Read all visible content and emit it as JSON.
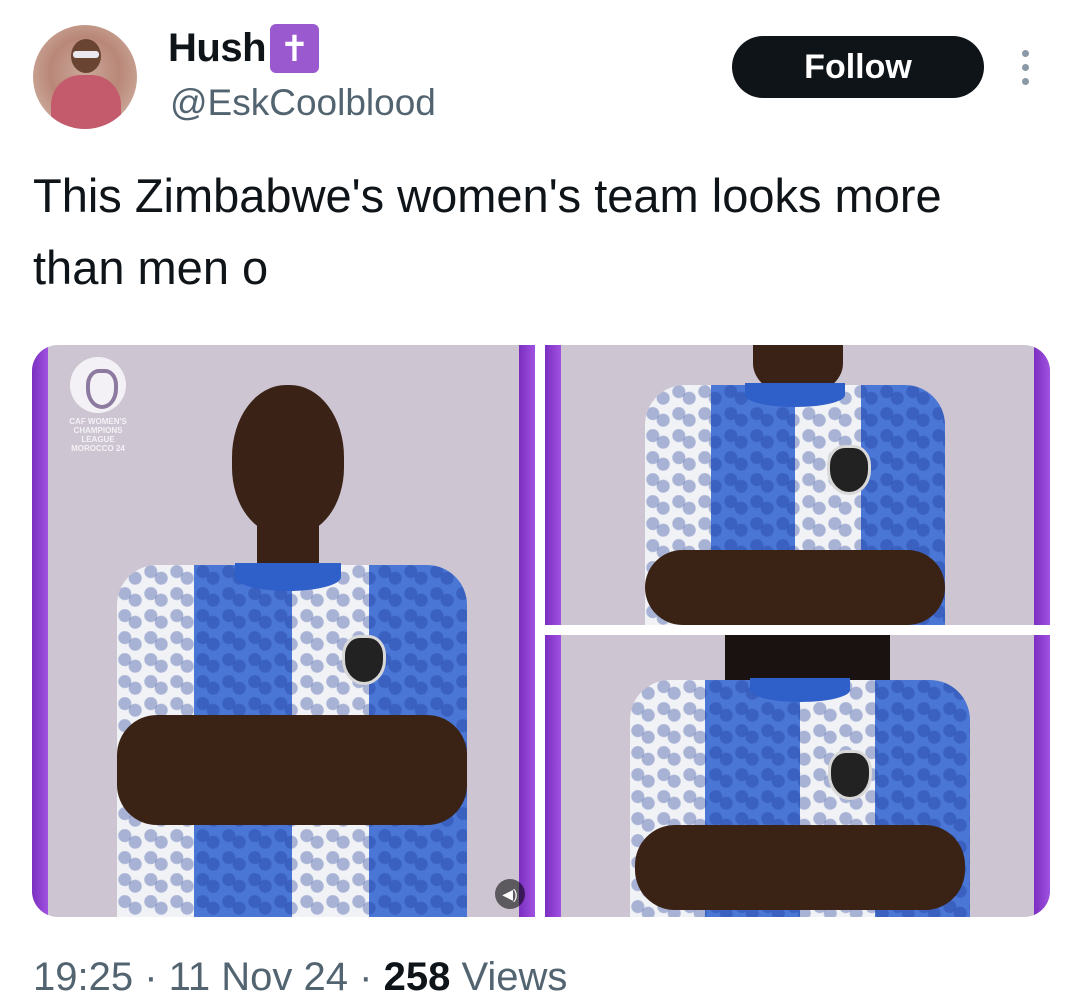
{
  "user": {
    "display_name": "Hush",
    "badge_glyph": "✝",
    "handle": "@EskCoolblood",
    "avatar_icon": "avatar"
  },
  "actions": {
    "follow_label": "Follow",
    "more_icon": "more-options-icon"
  },
  "tweet": {
    "text": "This Zimbabwe's women's team looks more than men o"
  },
  "media": {
    "caf_logo_text": "CAF WOMEN'S CHAMPIONS LEAGUE MOROCCO 24",
    "video_icon": "◀)"
  },
  "meta": {
    "time": "19:25",
    "sep1": " · ",
    "date": "11 Nov 24",
    "sep2": " · ",
    "views_count": "258",
    "views_label": " Views"
  },
  "colors": {
    "follow_bg": "#0f1419",
    "badge_bg": "#9b59d0",
    "secondary_text": "#536471",
    "stripe_purple": "#8a3fd0"
  }
}
